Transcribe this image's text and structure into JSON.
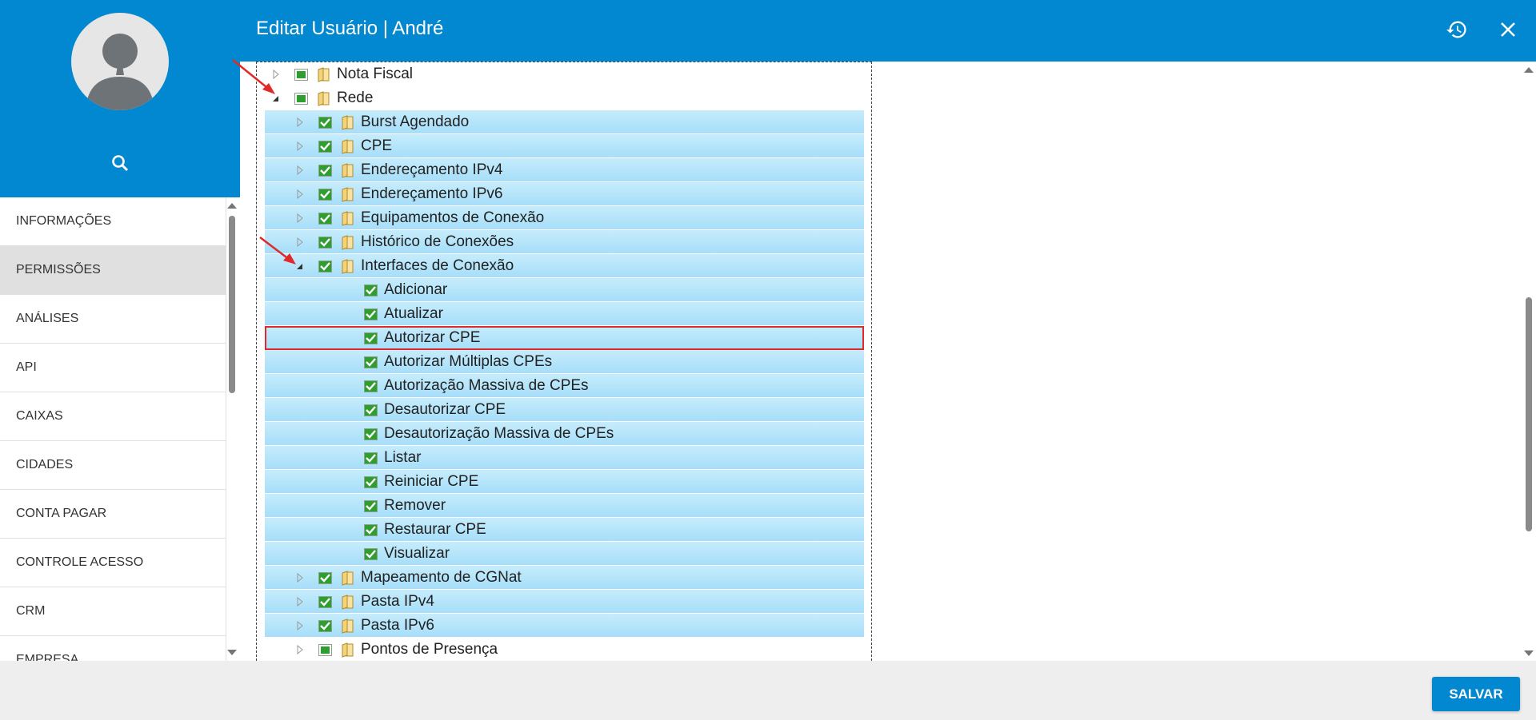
{
  "header": {
    "title": "Editar Usuário | André",
    "history_icon": "history-icon",
    "close_icon": "close-icon"
  },
  "sidebar": {
    "avatar_icon": "user-avatar-icon",
    "search_icon": "search-icon",
    "items": [
      {
        "label": "INFORMAÇÕES"
      },
      {
        "label": "PERMISSÕES",
        "active": true
      },
      {
        "label": "ANÁLISES"
      },
      {
        "label": "API"
      },
      {
        "label": "CAIXAS"
      },
      {
        "label": "CIDADES"
      },
      {
        "label": "CONTA PAGAR"
      },
      {
        "label": "CONTROLE ACESSO"
      },
      {
        "label": "CRM"
      },
      {
        "label": "EMPRESA"
      }
    ]
  },
  "tree": {
    "nota_fiscal": "Nota Fiscal",
    "rede": "Rede",
    "rede_children": [
      "Burst Agendado",
      "CPE",
      "Endereçamento IPv4",
      "Endereçamento IPv6",
      "Equipamentos de Conexão",
      "Histórico de Conexões",
      "Interfaces de Conexão"
    ],
    "interfaces_children": [
      "Adicionar",
      "Atualizar",
      "Autorizar CPE",
      "Autorizar Múltiplas CPEs",
      "Autorização Massiva de CPEs",
      "Desautorizar CPE",
      "Desautorização Massiva de CPEs",
      "Listar",
      "Reiniciar CPE",
      "Remover",
      "Restaurar CPE",
      "Visualizar"
    ],
    "rede_tail": [
      "Mapeamento de CGNat",
      "Pasta IPv4",
      "Pasta IPv6",
      "Pontos de Presença"
    ],
    "highlighted_item": "Autorizar CPE"
  },
  "footer": {
    "save_label": "SALVAR"
  },
  "colors": {
    "primary": "#0288d1",
    "row_highlight": "#b3e5fc",
    "annotation_red": "#e02a2a",
    "check_green": "#2e9e2e"
  }
}
